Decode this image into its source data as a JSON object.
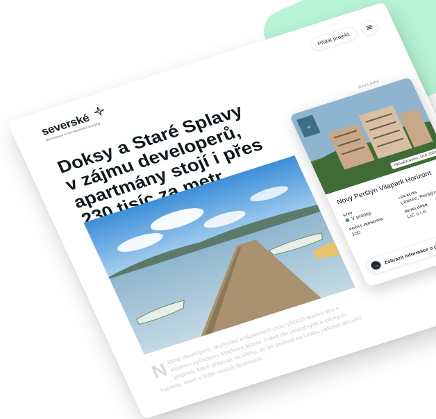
{
  "brand": {
    "name": "severské",
    "tagline": "Novostavby a developerské projekty"
  },
  "header": {
    "add_project_label": "Přidat projekt"
  },
  "article": {
    "title": "Doksy a Staré Splavy v zájmu developerů, apartmány stojí i přes 230 tisíc za metr čtvereční",
    "lead_dropcap": "N",
    "lead_text": "ástup developerů, ubytování a slunečních prací přiblížil realitní trhu s vlastním způsobem Machova jezera. Právě dle umístěných a cílených projektů, které přibývají na břehu, se lze podívat na kvalitu celkové aktuální kapacity, které v době nových fenoménů..."
  },
  "sidebar": {
    "ad_label": "REKLAMA",
    "card": {
      "title": "Nový Perštýn Vilapark Horizont",
      "image_badge": "Aktualizováno: 18.8.2024",
      "fields": [
        {
          "key": "STAV",
          "value": "V prodeji",
          "status_color": "#1fae55"
        },
        {
          "key": "LOKALITA",
          "value": "Liberec, Perštýn"
        },
        {
          "key": "POČET JEDNOTEK",
          "value": "100"
        },
        {
          "key": "DEVELOPER",
          "value": "LIC s.r.o."
        }
      ],
      "cta_label": "Zobrazit informace o projektu"
    }
  },
  "colors": {
    "accent_mint": "#b7f3d6",
    "text_dark": "#0f1a1d",
    "status_green": "#1fae55"
  }
}
